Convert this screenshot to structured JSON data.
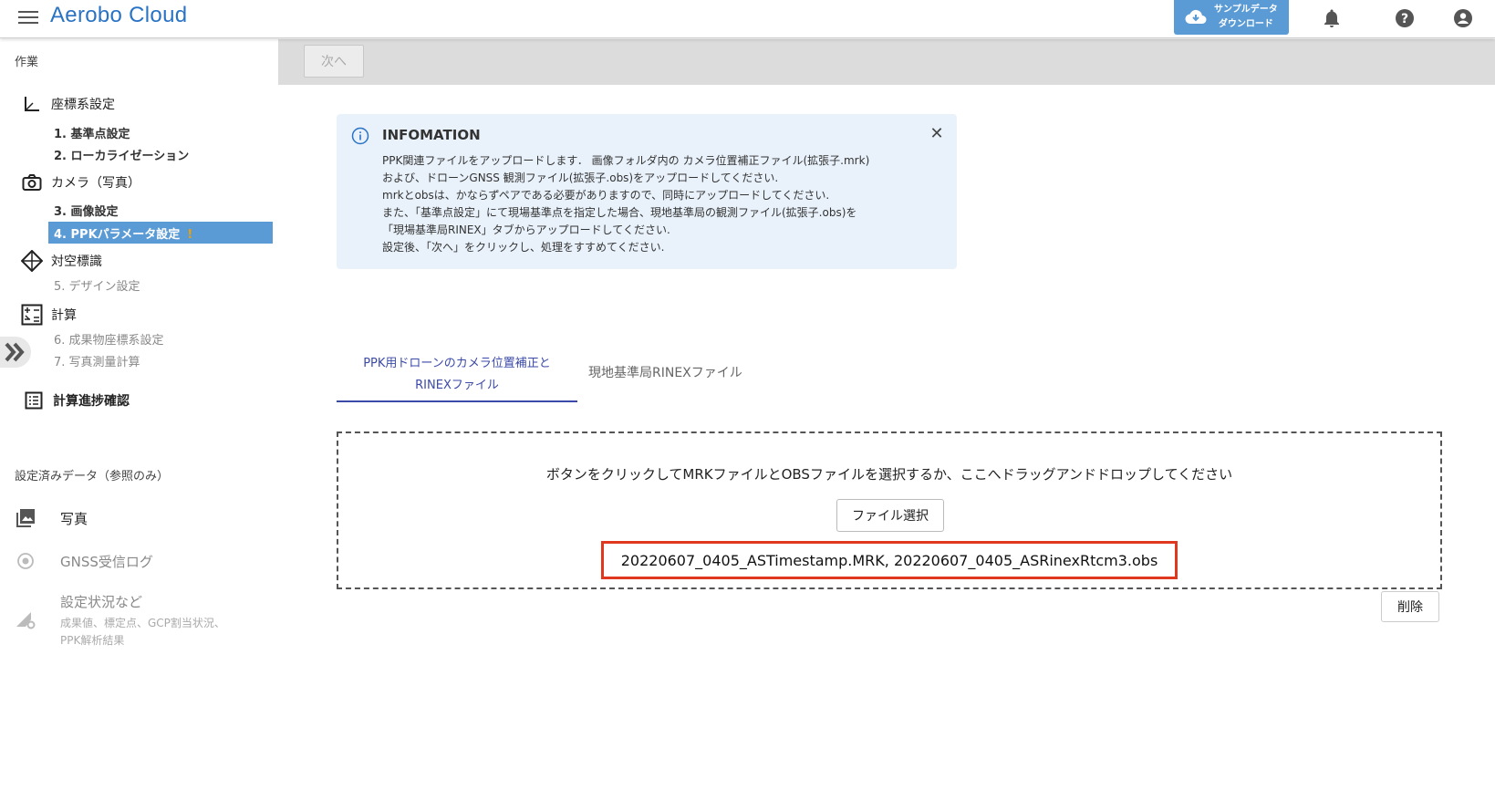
{
  "header": {
    "app_title": "Aerobo Cloud",
    "download_label_1": "サンプルデータ",
    "download_label_2": "ダウンロード",
    "accent_color": "#5b9bd5"
  },
  "sidebar": {
    "section_work": "作業",
    "groups": [
      {
        "label": "座標系設定",
        "icon": "axis-icon"
      },
      {
        "label": "カメラ（写真）",
        "icon": "camera-icon"
      },
      {
        "label": "対空標識",
        "icon": "diamond-target-icon"
      },
      {
        "label": "計算",
        "icon": "calculator-icon"
      },
      {
        "label": "計算進捗確認",
        "icon": "list-icon"
      }
    ],
    "steps": [
      {
        "label": "1. 基準点設定",
        "state": "done"
      },
      {
        "label": "2. ローカライゼーション",
        "state": "done"
      },
      {
        "label": "3. 画像設定",
        "state": "done"
      },
      {
        "label": "4. PPKパラメータ設定",
        "state": "active",
        "warning": "!"
      },
      {
        "label": "5. デザイン設定",
        "state": "todo"
      },
      {
        "label": "6. 成果物座標系設定",
        "state": "todo"
      },
      {
        "label": "7. 写真測量計算",
        "state": "todo"
      }
    ],
    "section_ref": "設定済みデータ（参照のみ）",
    "refs": [
      {
        "label": "写真",
        "icon": "photo-icon"
      },
      {
        "label": "GNSS受信ログ",
        "icon": "radio-icon"
      },
      {
        "label": "設定状況など",
        "sub": "成果値、標定点、GCP割当状況、",
        "sub2": "PPK解析結果",
        "icon": "settings-chart-icon"
      }
    ]
  },
  "toolbar": {
    "next_label": "次へ"
  },
  "info": {
    "title": "INFOMATION",
    "lines": [
      "PPK関連ファイルをアップロードします．  画像フォルダ内の カメラ位置補正ファイル(拡張子.mrk)",
      "および、ドローンGNSS 観測ファイル(拡張子.obs)をアップロードしてください.",
      "mrkとobsは、かならずペアである必要がありますので、同時にアップロードしてください.",
      "また、「基準点設定」にて現場基準点を指定した場合、現地基準局の観測ファイル(拡張子.obs)を",
      "「現場基準局RINEX」タブからアップロードしてください.",
      "設定後、「次へ」をクリックし、処理をすすめてください."
    ]
  },
  "tabs": {
    "tab1_line1": "PPK用ドローンのカメラ位置補正と",
    "tab1_line2": "RINEXファイル",
    "tab2": "現地基準局RINEXファイル"
  },
  "upload": {
    "message": "ボタンをクリックしてMRKファイルとOBSファイルを選択するか、ここへドラッグアンドドロップしてください",
    "select_button": "ファイル選択",
    "file_names": "20220607_0405_ASTimestamp.MRK, 20220607_0405_ASRinexRtcm3.obs",
    "delete_button": "削除"
  }
}
